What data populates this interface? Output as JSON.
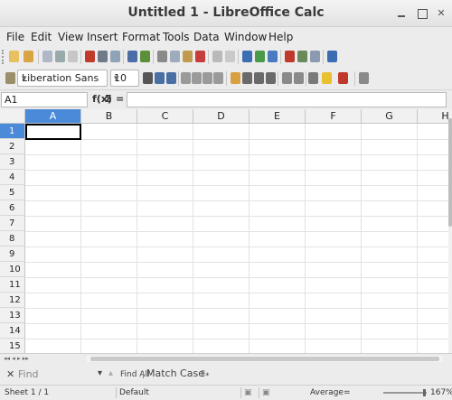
{
  "window": {
    "title": "Untitled 1 - LibreOffice Calc"
  },
  "menu": [
    "File",
    "Edit",
    "View",
    "Insert",
    "Format",
    "Tools",
    "Data",
    "Window",
    "Help"
  ],
  "format_toolbar": {
    "font_name": "Liberation Sans",
    "font_size": "10"
  },
  "formula_bar": {
    "cell_ref": "A1",
    "fx_symbol": "f(x)",
    "sum_symbol": "Σ",
    "equals_symbol": "=",
    "content": ""
  },
  "columns": [
    "A",
    "B",
    "C",
    "D",
    "E",
    "F",
    "G",
    "H"
  ],
  "rows": [
    "1",
    "2",
    "3",
    "4",
    "5",
    "6",
    "7",
    "8",
    "9",
    "10",
    "11",
    "12",
    "13",
    "14",
    "15"
  ],
  "active_cell": {
    "column": "A",
    "row": "1"
  },
  "find_bar": {
    "placeholder": "Find",
    "find_all_label": "Find All",
    "match_case_label": "Match Case"
  },
  "status_bar": {
    "sheet": "Sheet 1 / 1",
    "page_style": "Default",
    "summary": "Average=",
    "zoom": "167%"
  },
  "colors": {
    "selection_header": "#4a8ad9",
    "grid_line": "#e2e2e2",
    "header_bg": "#f1f1f1"
  }
}
